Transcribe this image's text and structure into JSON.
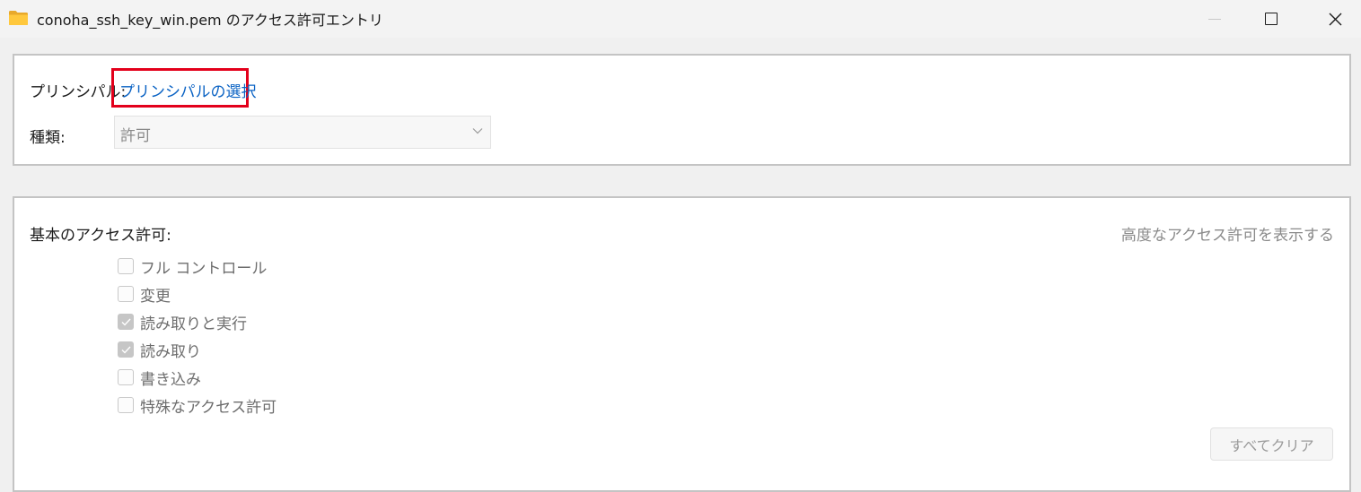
{
  "window": {
    "title": "conoha_ssh_key_win.pem のアクセス許可エントリ"
  },
  "principal": {
    "label": "プリンシパル:",
    "link_text": "プリンシパルの選択"
  },
  "type": {
    "label": "種類:",
    "selected": "許可"
  },
  "basic_permissions": {
    "label": "基本のアクセス許可:",
    "advanced_link": "高度なアクセス許可を表示する",
    "items": [
      {
        "label": "フル コントロール",
        "checked": false
      },
      {
        "label": "変更",
        "checked": false
      },
      {
        "label": "読み取りと実行",
        "checked": true
      },
      {
        "label": "読み取り",
        "checked": true
      },
      {
        "label": "書き込み",
        "checked": false
      },
      {
        "label": "特殊なアクセス許可",
        "checked": false
      }
    ]
  },
  "buttons": {
    "clear_all": "すべてクリア"
  },
  "colors": {
    "link": "#0b63c4",
    "highlight_border": "#e3001b",
    "folder": "#ffc83d"
  }
}
